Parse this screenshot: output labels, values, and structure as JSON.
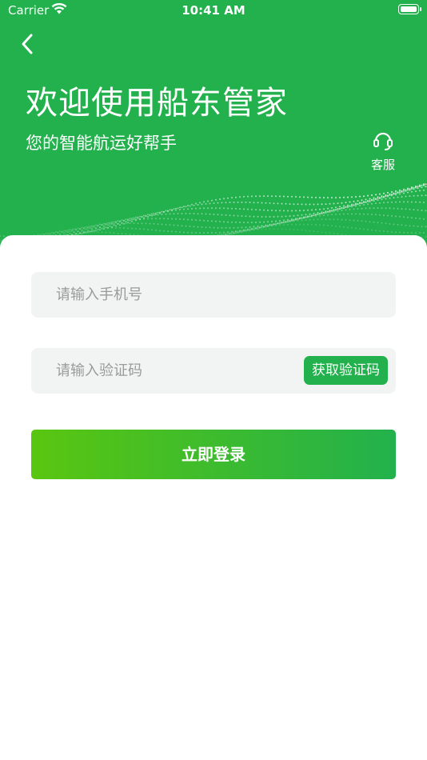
{
  "status_bar": {
    "carrier": "Carrier",
    "time": "10:41 AM"
  },
  "header": {
    "title": "欢迎使用船东管家",
    "subtitle": "您的智能航运好帮手",
    "service_label": "客服"
  },
  "form": {
    "phone_placeholder": "请输入手机号",
    "code_placeholder": "请输入验证码",
    "get_code_label": "获取验证码",
    "login_label": "立即登录"
  },
  "colors": {
    "brand": "#22b14c",
    "button_gradient_start": "#59c610",
    "input_bg": "#f2f4f3"
  },
  "icons": {
    "back": "chevron-left-icon",
    "service": "headset-icon",
    "wifi": "wifi-icon",
    "battery": "battery-icon"
  }
}
